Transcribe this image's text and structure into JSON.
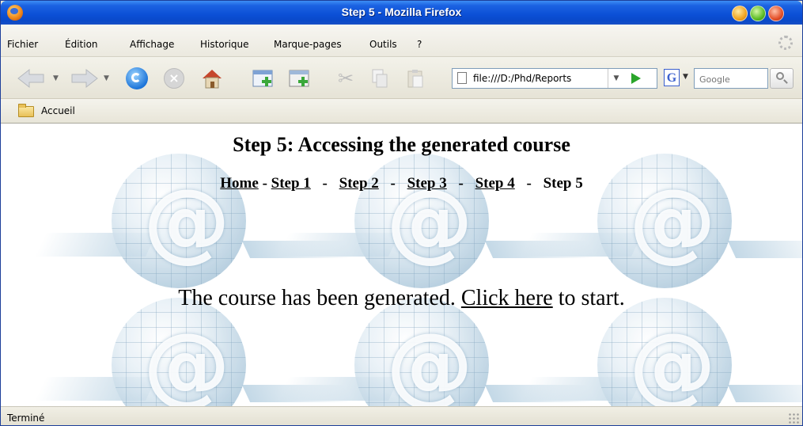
{
  "window": {
    "title": "Step 5 - Mozilla Firefox"
  },
  "menu": {
    "items": [
      "Fichier",
      "Édition",
      "Affichage",
      "Historique",
      "Marque-pages",
      "Outils",
      "?"
    ]
  },
  "toolbar": {
    "url": "file:///D:/Phd/Reports",
    "search_placeholder": "Google",
    "icons": [
      "back-arrow-icon",
      "forward-arrow-icon",
      "reload-icon",
      "stop-icon",
      "home-icon",
      "new-tab-icon",
      "new-window-icon",
      "cut-icon",
      "copy-icon",
      "paste-icon",
      "go-icon",
      "google-icon",
      "search-icon"
    ]
  },
  "bookmarks": {
    "items": [
      "Accueil"
    ]
  },
  "page": {
    "heading": "Step 5: Accessing the generated course",
    "steps": {
      "home": "Home",
      "step1": "Step 1",
      "step2": "Step 2",
      "step3": "Step 3",
      "step4": "Step 4",
      "step5": "Step 5",
      "separator": "-"
    },
    "message": {
      "before": "The course has been generated.",
      "link": "Click here",
      "after": "to start."
    },
    "background_symbol": "@"
  },
  "status": {
    "text": "Terminé"
  },
  "colors": {
    "titlebar": "#0b4fd6",
    "chrome": "#ece9d8",
    "link": "#000000"
  }
}
